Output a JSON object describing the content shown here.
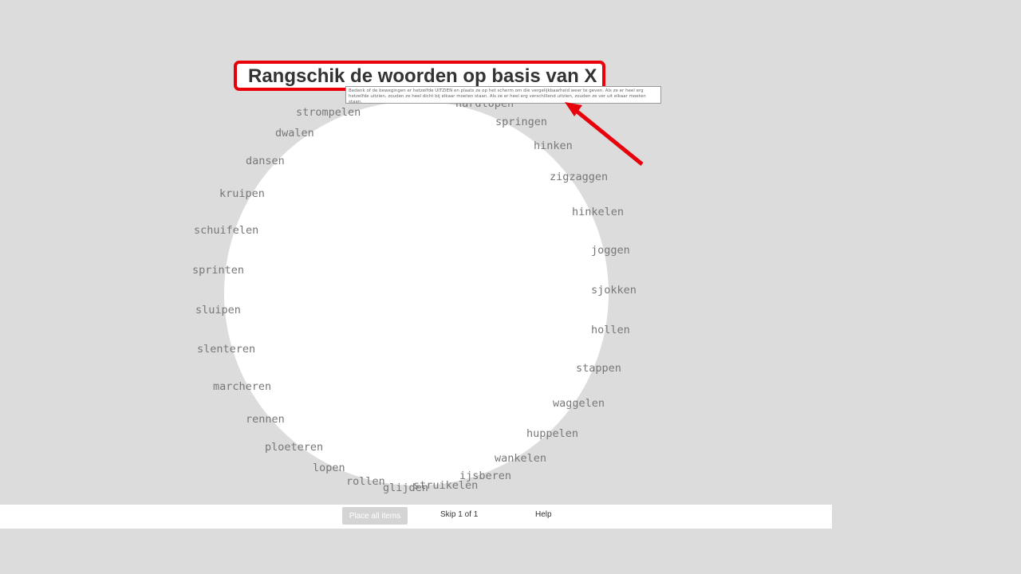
{
  "title": "Rangschik de woorden op basis van X",
  "instructions": "Bedenk of de bewegingen er hetzelfde UITZIEN en plaats ze op het scherm om die vergelijkbaarheid weer te geven. Als ze er heel erg hetzelfde uitzien, zouden ze heel dicht bij elkaar moeten staan. Als ze er heel erg verschillend uitzien, zouden ze ver uit elkaar moeten staan.",
  "colors": {
    "accent": "#e8000b",
    "background": "#dcdcdc",
    "word": "#777777"
  },
  "words": [
    "hardlopen",
    "springen",
    "hinken",
    "zigzaggen",
    "hinkelen",
    "joggen",
    "sjokken",
    "hollen",
    "stappen",
    "waggelen",
    "huppelen",
    "wankelen",
    "ijsberen",
    "struikelen",
    "glijden",
    "rollen",
    "lopen",
    "ploeteren",
    "rennen",
    "marcheren",
    "slenteren",
    "sluipen",
    "sprinten",
    "schuifelen",
    "kruipen",
    "dansen",
    "dwalen",
    "strompelen"
  ],
  "footer": {
    "place_all": "Place all items",
    "skip": "Skip 1 of 1",
    "help": "Help"
  }
}
